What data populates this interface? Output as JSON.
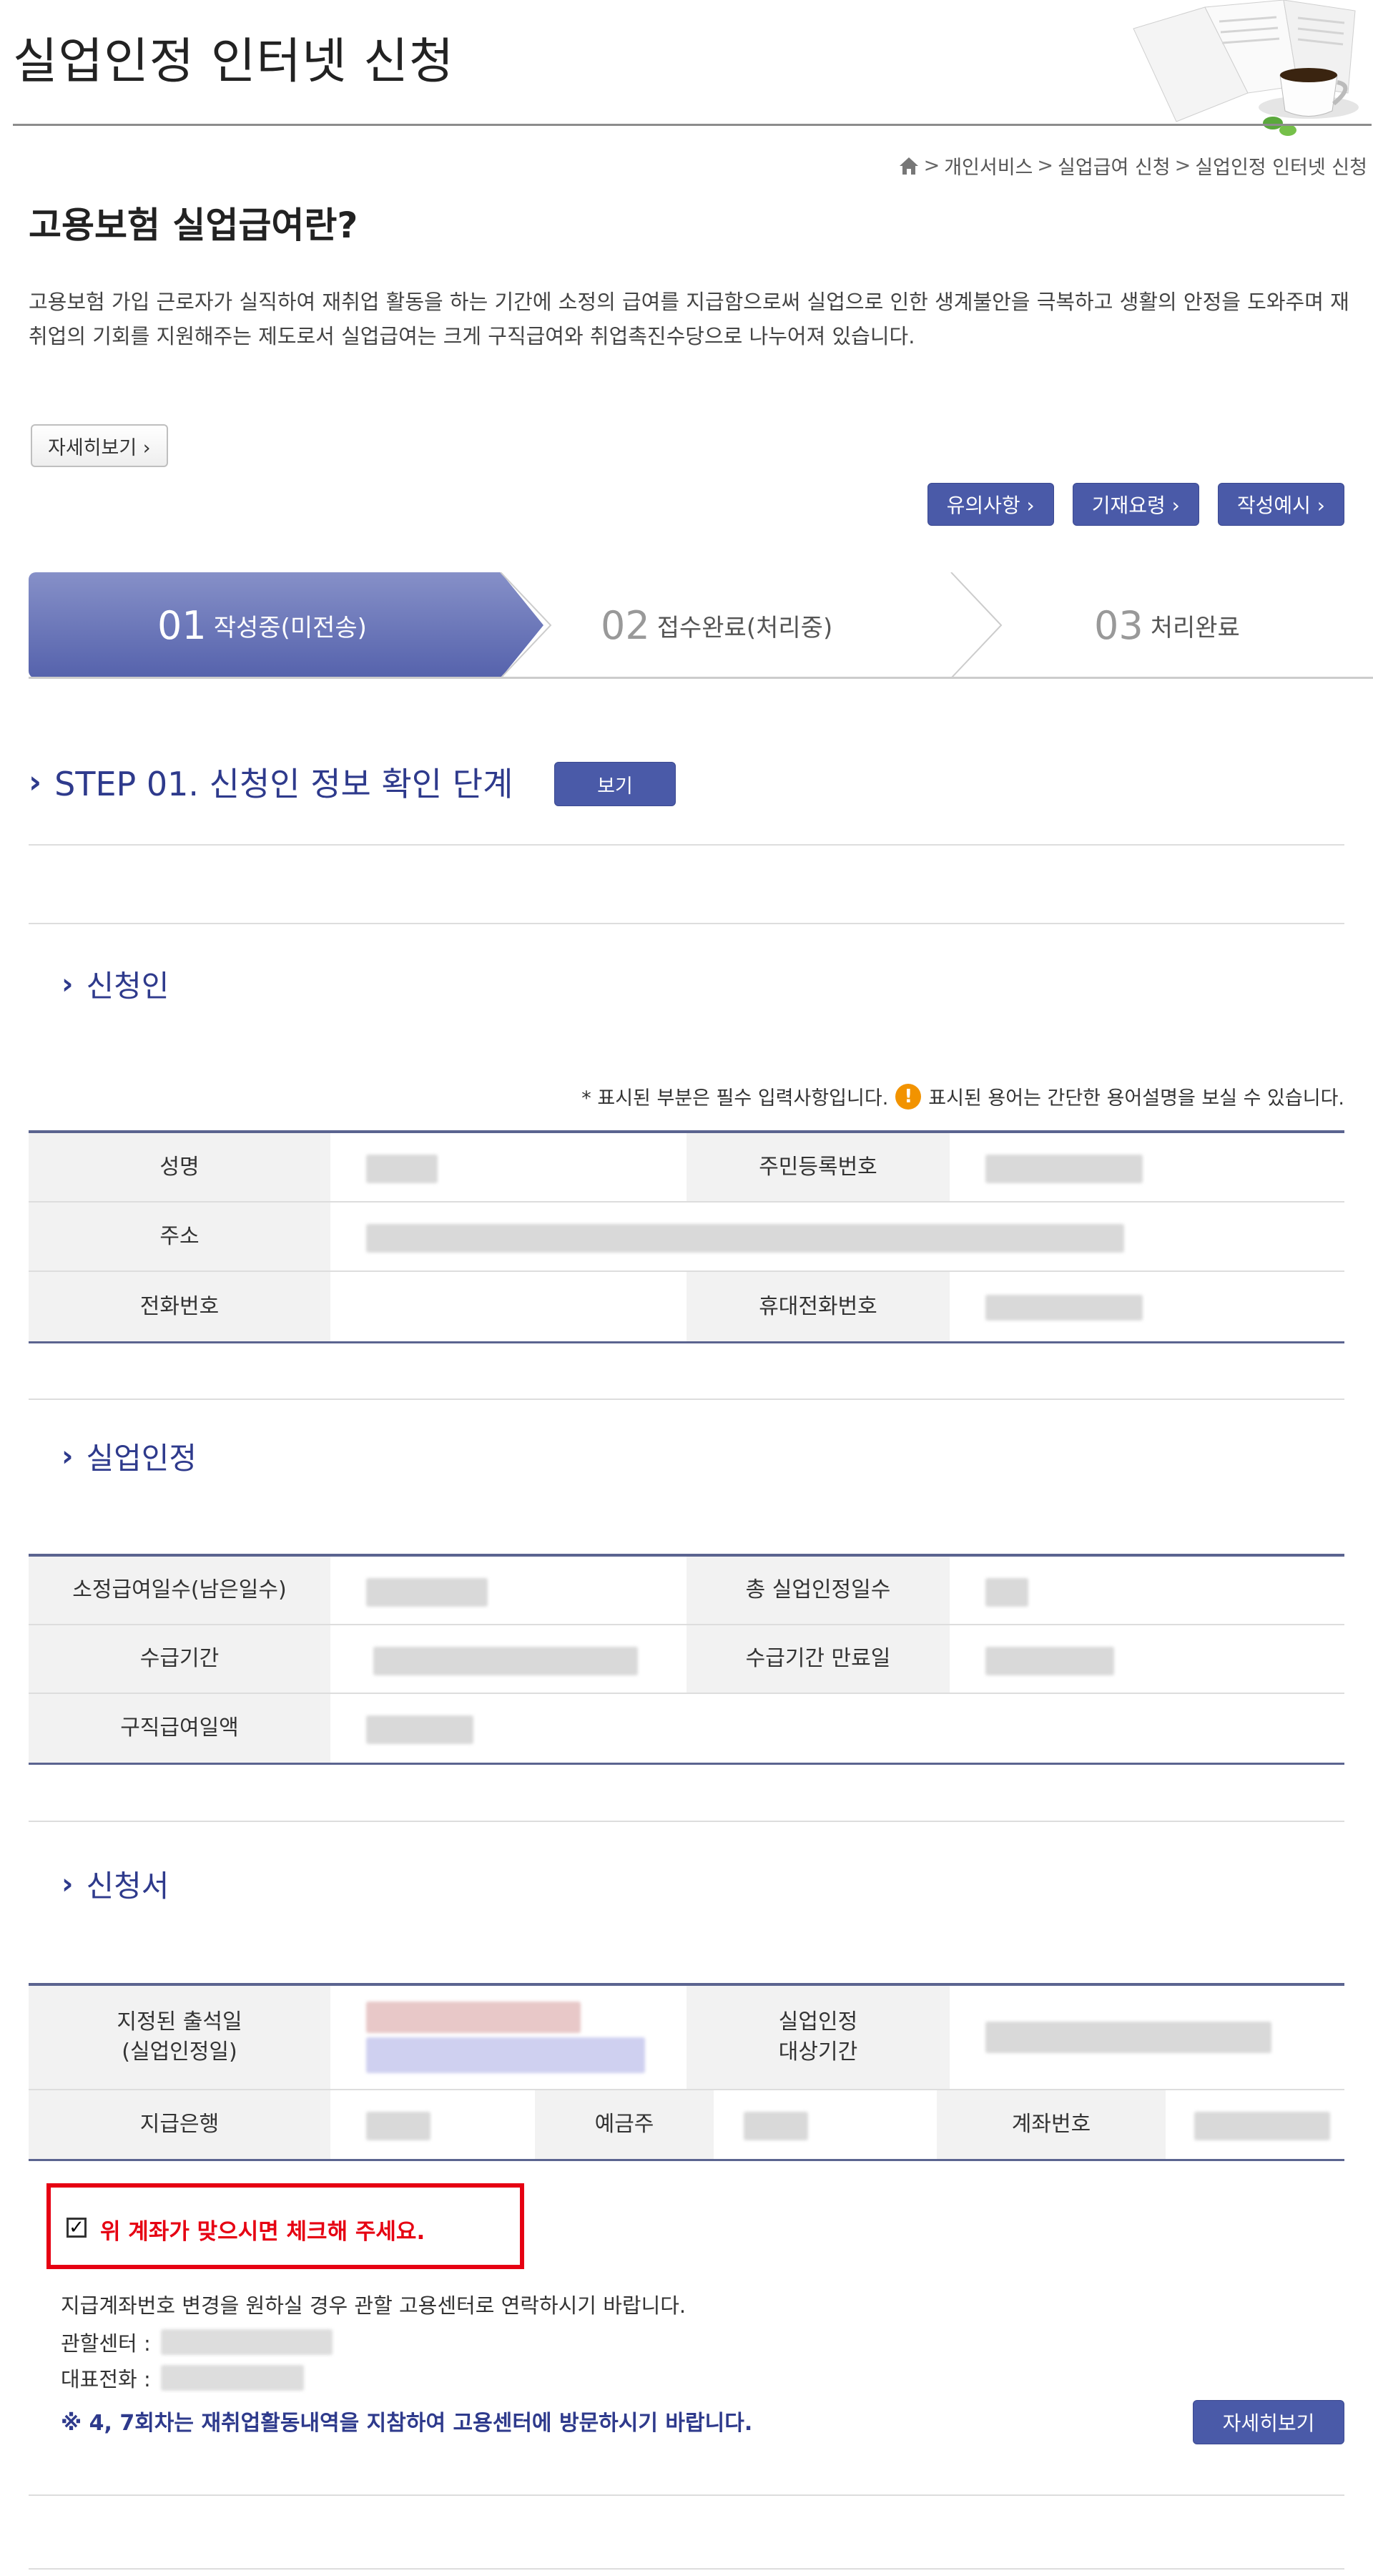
{
  "header": {
    "title": "실업인정 인터넷 신청"
  },
  "breadcrumb": {
    "items": [
      "개인서비스",
      "실업급여 신청",
      "실업인정 인터넷 신청"
    ],
    "separator": ">"
  },
  "intro": {
    "heading": "고용보험 실업급여란?",
    "text": "고용보험 가입 근로자가 실직하여 재취업 활동을 하는 기간에 소정의 급여를 지급함으로써 실업으로 인한 생계불안을 극복하고 생활의 안정을 도와주며 재취업의 기회를 지원해주는 제도로서 실업급여는 크게 구직급여와 취업촉진수당으로 나누어져 있습니다.",
    "detail_button": "자세히보기 ›"
  },
  "top_buttons": [
    "유의사항 ›",
    "기재요령 ›",
    "작성예시 ›"
  ],
  "steps": [
    {
      "num": "01",
      "label": "작성중(미전송)",
      "active": true
    },
    {
      "num": "02",
      "label": "접수완료(처리중)",
      "active": false
    },
    {
      "num": "03",
      "label": "처리완료",
      "active": false
    }
  ],
  "step_heading": {
    "title": "STEP 01. 신청인 정보 확인 단계",
    "view_button": "보기"
  },
  "applicant": {
    "title": "신청인",
    "note_required": "* 표시된 부분은 필수 입력사항입니다.",
    "note_glossary": "표시된 용어는 간단한 용어설명을 보실 수 있습니다.",
    "note_icon": "!",
    "labels": {
      "name": "성명",
      "resident_no": "주민등록번호",
      "address": "주소",
      "phone": "전화번호",
      "mobile": "휴대전화번호"
    }
  },
  "recognition": {
    "title": "실업인정",
    "labels": {
      "remaining_days": "소정급여일수(남은일수)",
      "total_days": "총 실업인정일수",
      "period": "수급기간",
      "period_end": "수급기간 만료일",
      "daily_amount": "구직급여일액"
    }
  },
  "application": {
    "title": "신청서",
    "labels": {
      "attendance_day": "지정된 출석일\n(실업인정일)",
      "target_period": "실업인정\n대상기간",
      "bank": "지급은행",
      "holder": "예금주",
      "account": "계좌번호"
    }
  },
  "confirm": {
    "checkbox_mark": "✓",
    "checkbox_label": "위 계좌가 맞으시면 체크해 주세요.",
    "change_notice": "지급계좌번호 변경을 원하실 경우 관할 고용센터로 연락하시기 바랍니다.",
    "center_label": "관할센터 :",
    "tel_label": "대표전화 :",
    "warning": "※ 4, 7회차는 재취업활동내역을 지참하여 고용센터에 방문하시기 바랍니다.",
    "detail_button": "자세히보기"
  },
  "icons": {
    "home": "home-icon",
    "chevron": "chevron-right-icon",
    "warning": "exclamation-icon"
  },
  "colors": {
    "accent": "#4a5aa8",
    "heading": "#2e3a8c",
    "alert": "#e60012",
    "notice": "#f29300"
  }
}
